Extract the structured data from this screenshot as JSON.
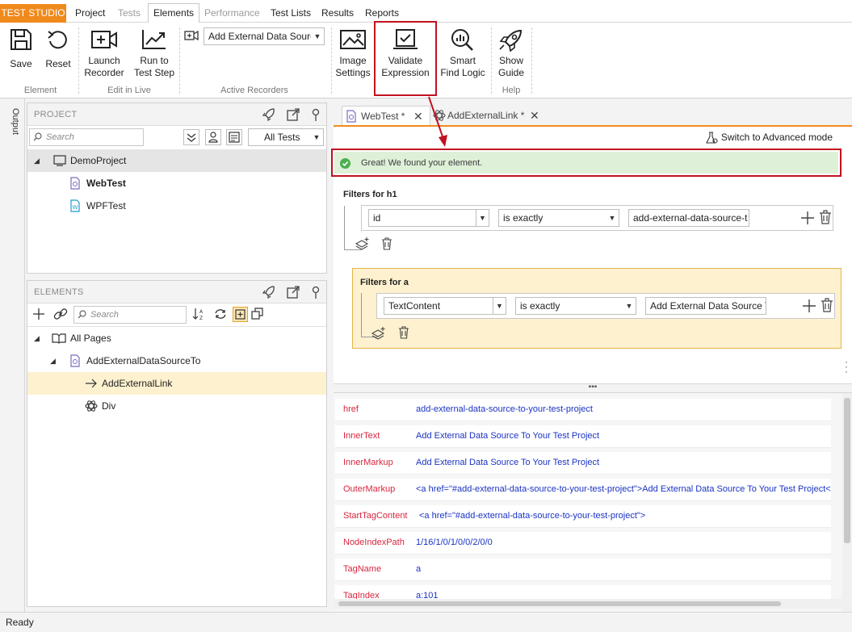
{
  "menubar": {
    "brand": "TEST STUDIO",
    "tabs": [
      {
        "label": "Project",
        "state": "normal"
      },
      {
        "label": "Tests",
        "state": "disabled"
      },
      {
        "label": "Elements",
        "state": "active"
      },
      {
        "label": "Performance",
        "state": "disabled"
      },
      {
        "label": "Test Lists",
        "state": "normal"
      },
      {
        "label": "Results",
        "state": "normal"
      },
      {
        "label": "Reports",
        "state": "normal"
      }
    ]
  },
  "ribbon": {
    "save": "Save",
    "reset": "Reset",
    "launch_recorder": [
      "Launch",
      "Recorder"
    ],
    "run_to_step": [
      "Run to",
      "Test Step"
    ],
    "recorder_select": "Add External Data Source",
    "image_settings": [
      "Image",
      "Settings"
    ],
    "validate_expression": [
      "Validate",
      "Expression"
    ],
    "smart_find_logic": [
      "Smart",
      "Find Logic"
    ],
    "show_guide": [
      "Show",
      "Guide"
    ],
    "groups": {
      "element": "Element",
      "edit_in_live": "Edit in Live",
      "active_recorders": "Active Recorders",
      "help": "Help"
    }
  },
  "sidestrip": {
    "output": "Output"
  },
  "project_panel": {
    "title": "PROJECT",
    "search_placeholder": "Search",
    "filter": "All Tests",
    "items": [
      {
        "label": "DemoProject"
      },
      {
        "label": "WebTest"
      },
      {
        "label": "WPFTest"
      }
    ]
  },
  "elements_panel": {
    "title": "ELEMENTS",
    "search_placeholder": "Search",
    "items": [
      {
        "label": "All Pages"
      },
      {
        "label": "AddExternalDataSourceTo"
      },
      {
        "label": "AddExternalLink"
      },
      {
        "label": "Div"
      }
    ]
  },
  "doc_tabs": [
    {
      "label": "WebTest *"
    },
    {
      "label": "AddExternalLink *"
    }
  ],
  "editor": {
    "advanced_mode": "Switch to Advanced mode",
    "success_message": "Great! We found your element.",
    "filters_h1": {
      "title": "Filters for h1",
      "attribute": "id",
      "operator": "is exactly",
      "value": "add-external-data-source-t"
    },
    "filters_a": {
      "title": "Filters for a",
      "attribute": "TextContent",
      "operator": "is exactly",
      "value": "Add External Data Source To"
    }
  },
  "properties": [
    {
      "name": "href",
      "value": "add-external-data-source-to-your-test-project"
    },
    {
      "name": "InnerText",
      "value": "Add External Data Source To Your Test Project"
    },
    {
      "name": "InnerMarkup",
      "value": "Add External Data Source To Your Test Project"
    },
    {
      "name": "OuterMarkup",
      "value": "<a href=\"#add-external-data-source-to-your-test-project\">Add External Data Source To Your Test Project</a>"
    },
    {
      "name": "StartTagContent",
      "value": "<a href=\"#add-external-data-source-to-your-test-project\">"
    },
    {
      "name": "NodeIndexPath",
      "value": "1/16/1/0/1/0/0/2/0/0"
    },
    {
      "name": "TagName",
      "value": "a"
    },
    {
      "name": "TagIndex",
      "value": "a:101"
    }
  ],
  "status": "Ready",
  "colors": {
    "accent": "#f08a1c",
    "highlight_red": "#c1121f",
    "success_bg": "#dff0d8",
    "success_icon": "#4caf50",
    "filter_a_bg": "#fdf1cf",
    "prop_name": "#d7263d",
    "prop_value": "#1a33c4"
  }
}
